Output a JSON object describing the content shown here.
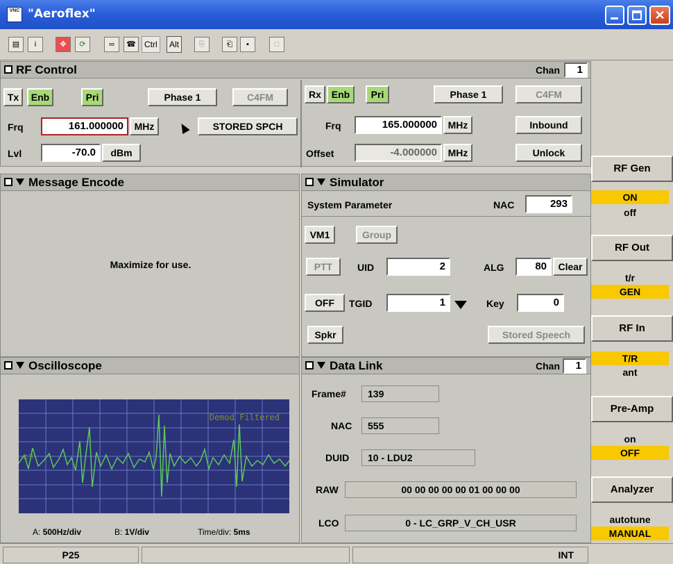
{
  "window": {
    "title": "\"Aeroflex\"",
    "vnc_badge": "VNC"
  },
  "toolbar": {
    "ctrl": "Ctrl",
    "alt": "Alt"
  },
  "rf_control": {
    "title": "RF Control",
    "chan_label": "Chan",
    "chan_value": "1",
    "tx": {
      "label": "Tx",
      "enb": "Enb",
      "pri": "Pri",
      "phase": "Phase 1",
      "mod": "C4FM",
      "frq_label": "Frq",
      "frq_value": "161.000000",
      "frq_unit": "MHz",
      "stored": "STORED SPCH",
      "lvl_label": "Lvl",
      "lvl_value": "-70.0",
      "lvl_unit": "dBm"
    },
    "rx": {
      "label": "Rx",
      "enb": "Enb",
      "pri": "Pri",
      "phase": "Phase 1",
      "mod": "C4FM",
      "frq_label": "Frq",
      "frq_value": "165.000000",
      "frq_unit": "MHz",
      "inbound": "Inbound",
      "offset_label": "Offset",
      "offset_value": "-4.000000",
      "offset_unit": "MHz",
      "unlock": "Unlock"
    }
  },
  "message_encode": {
    "title": "Message Encode",
    "body": "Maximize for use."
  },
  "simulator": {
    "title": "Simulator",
    "sys_param": "System Parameter",
    "nac_label": "NAC",
    "nac_value": "293",
    "vm1": "VM1",
    "group": "Group",
    "ptt": "PTT",
    "uid_label": "UID",
    "uid_value": "2",
    "alg_label": "ALG",
    "alg_value": "80",
    "clear": "Clear",
    "off": "OFF",
    "tgid_label": "TGID",
    "tgid_value": "1",
    "key_label": "Key",
    "key_value": "0",
    "spkr": "Spkr",
    "stored_speech": "Stored Speech"
  },
  "oscilloscope": {
    "title": "Oscilloscope",
    "trace_label": "Demod Filtered",
    "a_label": "A:",
    "a_value": "500Hz/div",
    "b_label": "B:",
    "b_value": "1V/div",
    "time_label": "Time/div:",
    "time_value": "5ms"
  },
  "data_link": {
    "title": "Data Link",
    "chan_label": "Chan",
    "chan_value": "1",
    "frame_label": "Frame#",
    "frame_value": "139",
    "nac_label": "NAC",
    "nac_value": "555",
    "duid_label": "DUID",
    "duid_value": "10 - LDU2",
    "raw_label": "RAW",
    "raw_value": "00 00 00 00 00 01 00 00 00",
    "lco_label": "LCO",
    "lco_value": "0 - LC_GRP_V_CH_USR"
  },
  "sidebar": {
    "rf_gen": {
      "label": "RF Gen",
      "opt1": "ON",
      "opt2": "off"
    },
    "rf_out": {
      "label": "RF Out",
      "opt1": "t/r",
      "opt2": "GEN"
    },
    "rf_in": {
      "label": "RF In",
      "opt1": "T/R",
      "opt2": "ant"
    },
    "pre_amp": {
      "label": "Pre-Amp",
      "opt1": "on",
      "opt2": "OFF"
    },
    "analyzer": {
      "label": "Analyzer",
      "opt1": "autotune",
      "opt2": "MANUAL"
    }
  },
  "status": {
    "mode": "P25",
    "clock": "INT"
  },
  "colors": {
    "accent_yellow": "#f8c800",
    "enable_green": "#a8d878",
    "trace_green": "#5ac85a",
    "scope_bg": "#2c3278"
  }
}
